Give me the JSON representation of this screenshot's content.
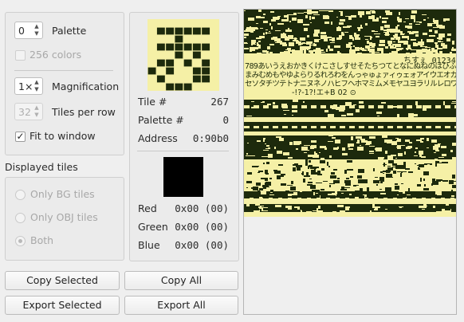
{
  "palette": {
    "value": "0",
    "label": "Palette"
  },
  "colors256": {
    "label": "256 colors"
  },
  "magnification": {
    "value": "1×",
    "label": "Magnification"
  },
  "tiles_per_row": {
    "value": "32",
    "label": "Tiles per row"
  },
  "fit_window": {
    "label": "Fit to window",
    "checked_mark": "✓"
  },
  "displayed_tiles": {
    "title": "Displayed tiles",
    "options": [
      "Only BG tiles",
      "Only OBJ tiles",
      "Both"
    ]
  },
  "tile_info": {
    "tile_label": "Tile #",
    "tile_value": "267",
    "palette_label": "Palette #",
    "palette_value": "0",
    "address_label": "Address",
    "address_value": "0:90b0"
  },
  "color_info": {
    "red_label": "Red",
    "red_value": "0x00 (00)",
    "green_label": "Green",
    "green_value": "0x00 (00)",
    "blue_label": "Blue",
    "blue_value": "0x00 (00)",
    "swatch_color": "#000000"
  },
  "buttons": {
    "copy_selected": "Copy Selected",
    "copy_all": "Copy All",
    "export_selected": "Export Selected",
    "export_all": "Export All"
  },
  "tile_viewer": {
    "text_row1": "ちすぇ 0123456",
    "text_row2": "789あいうえおかきくけこさしすせそたちつてとなにぬねのはひふへほ",
    "text_row3": "まみむめもやゆよらりるれろわをんっゃゅょァィゥェォアイウエオカキクケコサシス",
    "text_row4": "セソタチツテトナニヌネノハヒフヘホマミムメモヤユヨラリルレロワヲン",
    "text_row5": "-!?-1?!エ+B 02 ⊙",
    "colors": {
      "dark": "#1d2a0c",
      "light": "#f5f0a6",
      "mid": "#8a8a52"
    }
  },
  "tile_pattern": [
    "00000000",
    "01111110",
    "00010000",
    "01111110",
    "00010100",
    "01101010",
    "10100110",
    "01000110",
    "00111000"
  ]
}
